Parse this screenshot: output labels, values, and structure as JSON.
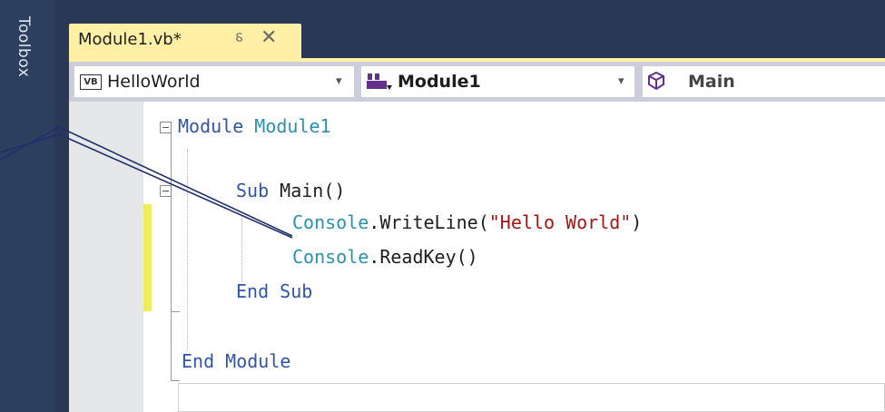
{
  "side_panel": {
    "label": "Toolbox"
  },
  "tab": {
    "title": "Module1.vb*",
    "pin_icon": "pin-icon",
    "close_icon": "close-icon"
  },
  "nav": {
    "project": "HelloWorld",
    "class": "Module1",
    "member": "Main",
    "dropdown_arrow": "▾"
  },
  "code_lines": [
    {
      "kw": "Module",
      "name": "Module1"
    },
    {},
    {
      "kw": "Sub",
      "name": "Main()"
    },
    {
      "obj": "Console",
      "call": ".WriteLine(",
      "str": "\"Hello World\"",
      "end": ")"
    },
    {
      "obj": "Console",
      "call": ".ReadKey()"
    },
    {
      "kw": "End Sub"
    },
    {},
    {
      "kw": "End Module"
    }
  ],
  "colors": {
    "frame": "#293955",
    "tab_active": "#fff0a6",
    "keyword": "#3055a6",
    "type": "#2b91af",
    "string": "#a31515",
    "change_bar": "#f1ec5b"
  }
}
